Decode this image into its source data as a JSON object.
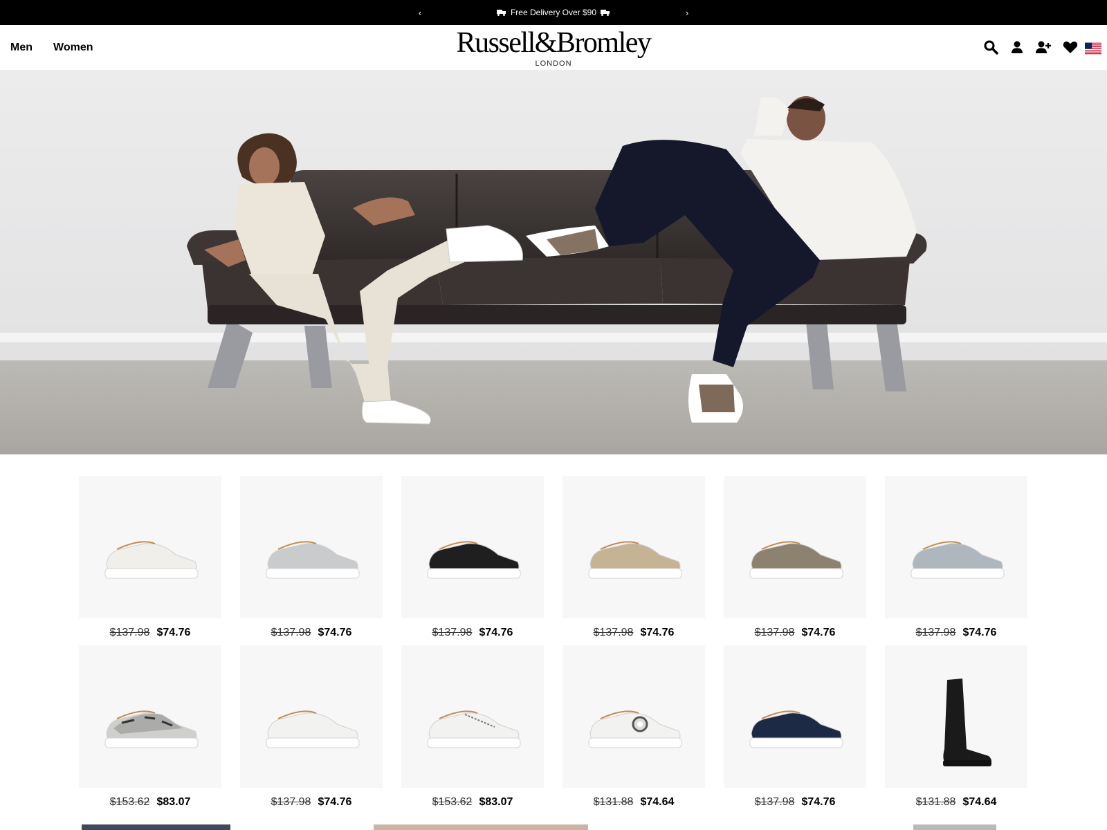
{
  "announcement": {
    "text": "Free Delivery Over $90",
    "prev_label": "‹",
    "next_label": "›"
  },
  "header": {
    "nav": [
      "Men",
      "Women"
    ],
    "logo_brand": "Russell&Bromley",
    "logo_city": "LONDON",
    "icons": [
      "search-icon",
      "account-icon",
      "register-icon",
      "wishlist-icon",
      "us-flag-icon"
    ]
  },
  "hero": {
    "alt": "lifestyle image of two models on a leather sofa"
  },
  "products": [
    {
      "was": "$137.98",
      "now": "$74.76",
      "color": "#f1efea",
      "type": "sneaker",
      "accent": "#9a8f86"
    },
    {
      "was": "$137.98",
      "now": "$74.76",
      "color": "#c9cbcd",
      "type": "sneaker",
      "accent": "#c9cbcd"
    },
    {
      "was": "$137.98",
      "now": "$74.76",
      "color": "#1f1f1f",
      "type": "sneaker",
      "accent": "#1f1f1f"
    },
    {
      "was": "$137.98",
      "now": "$74.76",
      "color": "#c6b394",
      "type": "sneaker",
      "accent": "#c6b394"
    },
    {
      "was": "$137.98",
      "now": "$74.76",
      "color": "#8d8170",
      "type": "sneaker",
      "accent": "#8d8170"
    },
    {
      "was": "$137.98",
      "now": "$74.76",
      "color": "#aeb6be",
      "type": "sneaker",
      "accent": "#aeb6be"
    },
    {
      "was": "$153.62",
      "now": "$83.07",
      "color": "#cfcfcc",
      "type": "snake",
      "accent": "#444"
    },
    {
      "was": "$137.98",
      "now": "$74.76",
      "color": "#f2f2f0",
      "type": "sneaker",
      "accent": "#f2f2f0"
    },
    {
      "was": "$153.62",
      "now": "$83.07",
      "color": "#f2f2f0",
      "type": "zip",
      "accent": "#888"
    },
    {
      "was": "$131.88",
      "now": "$74.64",
      "color": "#f2f2f0",
      "type": "jewel",
      "accent": "#555"
    },
    {
      "was": "$137.98",
      "now": "$74.76",
      "color": "#1d2a45",
      "type": "sneaker",
      "accent": "#1d2a45"
    },
    {
      "was": "$131.88",
      "now": "$74.64",
      "color": "#1a1a1a",
      "type": "boot",
      "accent": "#1a1a1a"
    }
  ]
}
